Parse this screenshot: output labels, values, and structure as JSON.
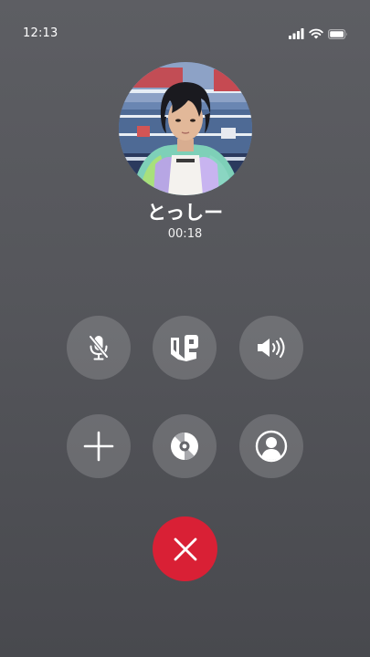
{
  "status_bar": {
    "time": "12:13",
    "icons": [
      "signal-icon",
      "wifi-icon",
      "battery-icon"
    ]
  },
  "caller": {
    "name": "とっしー",
    "duration": "00:18"
  },
  "controls": {
    "row1": [
      "mute-icon",
      "effects-icon",
      "speaker-icon"
    ],
    "row2": [
      "add-icon",
      "disc-icon",
      "profile-icon"
    ],
    "end_call": "close-icon"
  },
  "colors": {
    "background": "#55565b",
    "button": "#727377",
    "end_call": "#d92035",
    "text": "#ffffff"
  }
}
